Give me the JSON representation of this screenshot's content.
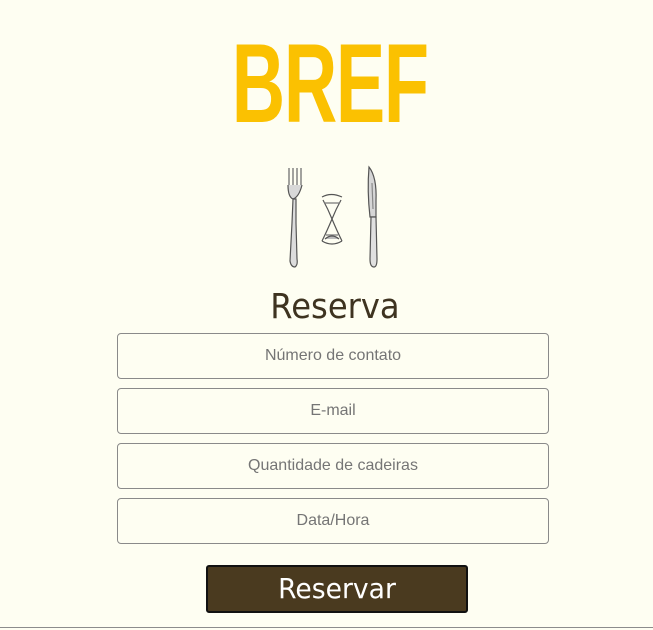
{
  "brand": {
    "logo_text": "BREF",
    "logo_color": "#fbc101",
    "emblem_icon": "cutlery-hourglass-icon"
  },
  "form": {
    "title": "Reserva",
    "fields": {
      "contact_placeholder": "Número de contato",
      "email_placeholder": "E-mail",
      "chairs_placeholder": "Quantidade de cadeiras",
      "datetime_placeholder": "Data/Hora"
    },
    "submit_label": "Reservar",
    "submit_color": "#4a3a1f"
  },
  "colors": {
    "background": "#fefef2",
    "title_text": "#3e3320"
  }
}
